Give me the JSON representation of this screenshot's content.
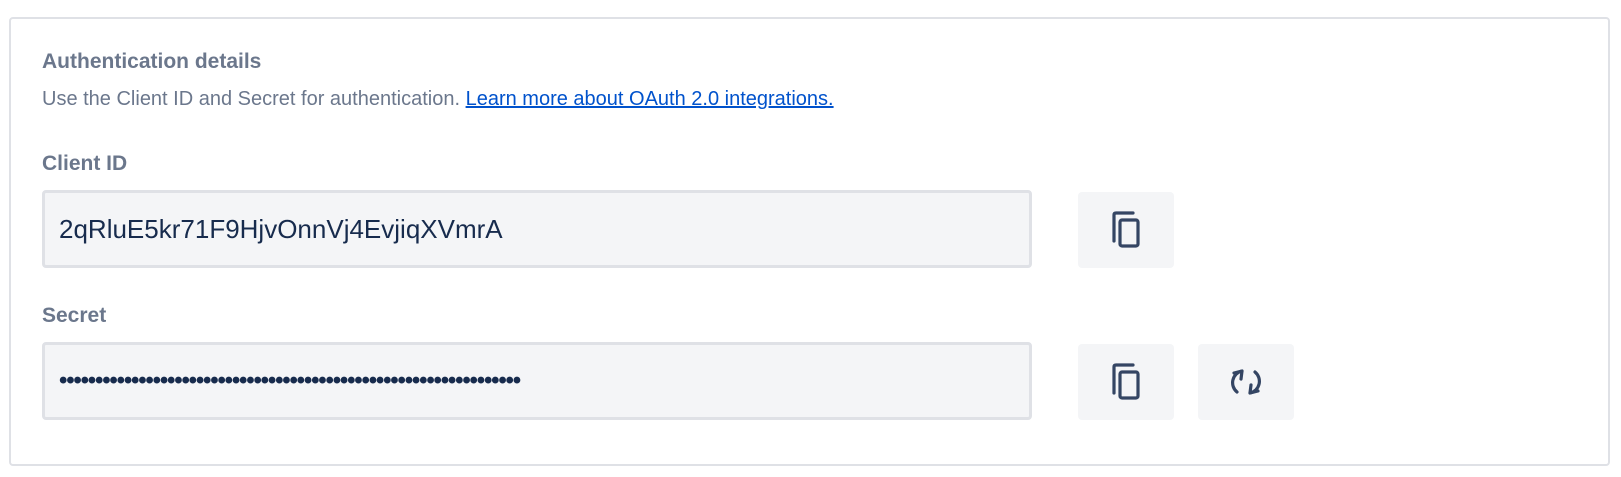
{
  "section": {
    "title": "Authentication details",
    "description": "Use the Client ID and Secret for authentication.",
    "learn_more_link": "Learn more about OAuth 2.0 integrations."
  },
  "client_id": {
    "label": "Client ID",
    "value": "2qRluE5kr71F9HjvOnnVj4EvjiqXVmrA",
    "copy_icon": "copy-icon"
  },
  "secret": {
    "label": "Secret",
    "value": "••••••••••••••••••••••••••••••••••••••••••••••••••••••••••••••••",
    "copy_icon": "copy-icon",
    "regenerate_icon": "refresh-icon"
  },
  "colors": {
    "label_gray": "#6b778c",
    "link_blue": "#0052cc",
    "text_dark": "#172b4d",
    "field_bg": "#f4f5f7",
    "border": "#dfe1e6"
  }
}
